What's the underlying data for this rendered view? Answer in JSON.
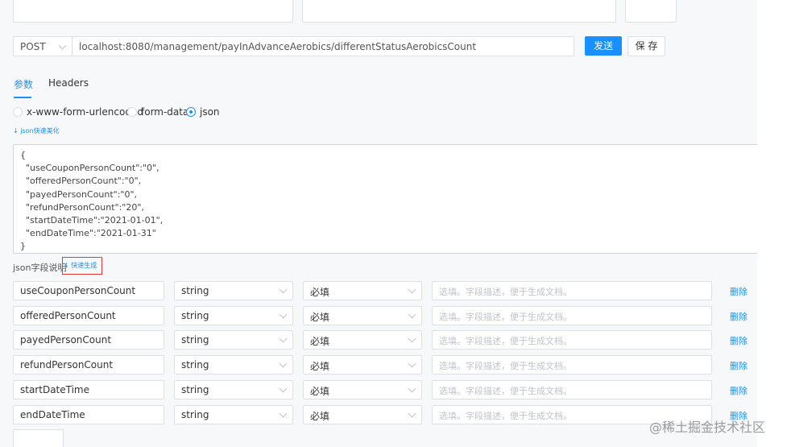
{
  "request": {
    "method": "POST",
    "url": "localhost:8080/management/payInAdvanceAerobics/differentStatusAerobicsCount",
    "send_label": "发送",
    "save_label": "保 存"
  },
  "tabs": [
    {
      "label": "参数",
      "active": true
    },
    {
      "label": "Headers",
      "active": false
    }
  ],
  "body_types": [
    {
      "label": "x-www-form-urlencoded",
      "selected": false
    },
    {
      "label": "form-data",
      "selected": false
    },
    {
      "label": "json",
      "selected": true
    }
  ],
  "json_beautify_label": "json快速美化",
  "json_body_lines": [
    "{",
    "  \"useCouponPersonCount\":\"0\",",
    "  \"offeredPersonCount\":\"0\",",
    "  \"payedPersonCount\":\"0\",",
    "  \"refundPersonCount\":\"20\",",
    "  \"startDateTime\":\"2021-01-01\",",
    "  \"endDateTime\":\"2021-01-31\"",
    "}"
  ],
  "fields_section": {
    "label": "json字段说明",
    "quick_generate_label": "快速生成"
  },
  "fields": [
    {
      "name": "useCouponPersonCount",
      "type": "string",
      "required": "必填",
      "desc_placeholder": "选填。字段描述，便于生成文档。",
      "delete_label": "删除"
    },
    {
      "name": "offeredPersonCount",
      "type": "string",
      "required": "必填",
      "desc_placeholder": "选填。字段描述，便于生成文档。",
      "delete_label": "删除"
    },
    {
      "name": "payedPersonCount",
      "type": "string",
      "required": "必填",
      "desc_placeholder": "选填。字段描述，便于生成文档。",
      "delete_label": "删除"
    },
    {
      "name": "refundPersonCount",
      "type": "string",
      "required": "必填",
      "desc_placeholder": "选填。字段描述，便于生成文档。",
      "delete_label": "删除"
    },
    {
      "name": "startDateTime",
      "type": "string",
      "required": "必填",
      "desc_placeholder": "选填。字段描述，便于生成文档。",
      "delete_label": "删除"
    },
    {
      "name": "endDateTime",
      "type": "string",
      "required": "必填",
      "desc_placeholder": "选填。字段描述，便于生成文档。",
      "delete_label": "删除"
    }
  ],
  "watermark": "@稀土掘金技术社区",
  "colors": {
    "accent": "#1890ff",
    "highlight_border": "#e53935"
  }
}
